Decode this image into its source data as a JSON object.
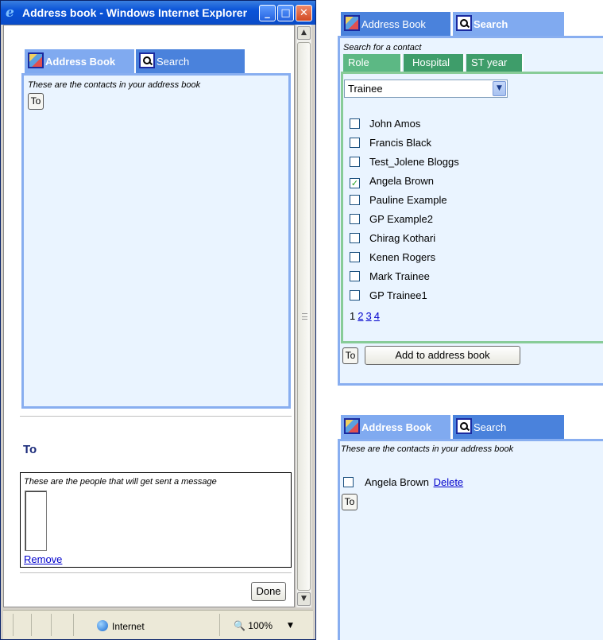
{
  "ie_window": {
    "title": "Address book - Windows Internet Explorer",
    "status_zone": "Internet",
    "zoom": "100%"
  },
  "tabs": {
    "address_book": "Address Book",
    "search": "Search"
  },
  "address_book_panel": {
    "note": "These are the contacts in your address book",
    "to_label": "To"
  },
  "to_section": {
    "heading": "To",
    "note": "These are the people that will get sent a message",
    "remove_link": "Remove",
    "done_button": "Done"
  },
  "search_panel": {
    "prompt": "Search for a contact",
    "subtabs": [
      "Role",
      "Hospital",
      "ST year"
    ],
    "role_select": "Trainee",
    "contacts": [
      {
        "name": "John Amos",
        "checked": false
      },
      {
        "name": "Francis Black",
        "checked": false
      },
      {
        "name": "Test_Jolene Bloggs",
        "checked": false
      },
      {
        "name": "Angela Brown",
        "checked": true
      },
      {
        "name": "Pauline Example",
        "checked": false
      },
      {
        "name": "GP Example2",
        "checked": false
      },
      {
        "name": "Chirag Kothari",
        "checked": false
      },
      {
        "name": "Kenen Rogers",
        "checked": false
      },
      {
        "name": "Mark Trainee",
        "checked": false
      },
      {
        "name": "GP Trainee1",
        "checked": false
      }
    ],
    "pager": {
      "current": "1",
      "pages": [
        "2",
        "3",
        "4"
      ]
    },
    "to_label": "To",
    "add_button": "Add to address book"
  },
  "address_book_result": {
    "note": "These are the contacts in your address book",
    "contact": "Angela Brown",
    "delete_link": "Delete",
    "to_label": "To"
  },
  "colors": {
    "tab_active": "#80aaf0",
    "tab_inactive": "#4a82dc",
    "panel_bg": "#eaf4ff",
    "subtab_green": "#3e9d6a",
    "heading_blue": "#1a2a7a"
  }
}
